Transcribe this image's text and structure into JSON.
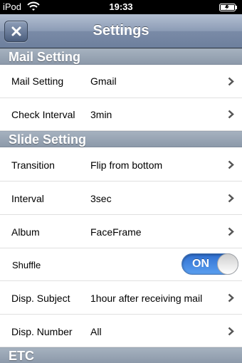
{
  "status_bar": {
    "carrier": "iPod",
    "time": "19:33"
  },
  "nav": {
    "title": "Settings"
  },
  "sections": {
    "mail": {
      "header": "Mail Setting",
      "rows": [
        {
          "label": "Mail Setting",
          "value": "Gmail"
        },
        {
          "label": "Check Interval",
          "value": "3min"
        }
      ]
    },
    "slide": {
      "header": "Slide Setting",
      "rows": [
        {
          "label": "Transition",
          "value": "Flip from bottom"
        },
        {
          "label": "Interval",
          "value": "3sec"
        },
        {
          "label": "Album",
          "value": "FaceFrame"
        },
        {
          "label": "Shuffle",
          "toggle": "ON"
        },
        {
          "label": "Disp. Subject",
          "value": "1hour after receiving mail"
        },
        {
          "label": "Disp. Number",
          "value": "All"
        }
      ]
    },
    "etc": {
      "header": "ETC"
    }
  },
  "colors": {
    "toggle_on": "#3d87e0",
    "section_header": "#98a5b5",
    "nav_bar": "#8c9cb6"
  },
  "icons": {
    "close": "close-icon",
    "chevron": "chevron-right-icon",
    "wifi": "wifi-icon",
    "battery": "battery-icon"
  }
}
